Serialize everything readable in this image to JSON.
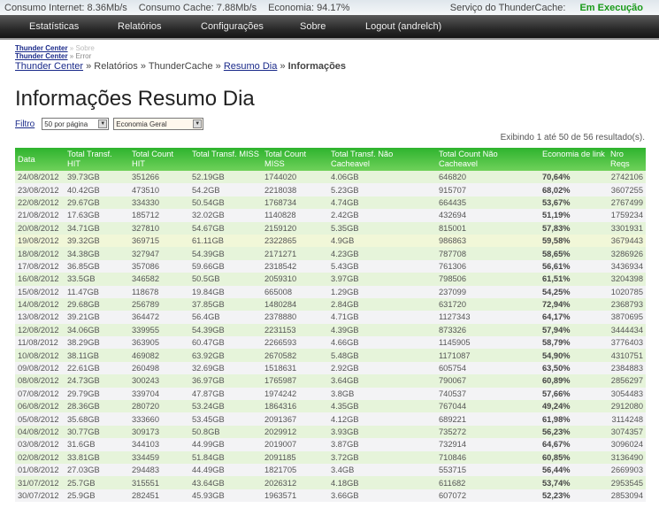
{
  "status": {
    "internet": "Consumo Internet: 8.36Mb/s",
    "cache": "Consumo Cache: 7.88Mb/s",
    "economia": "Economia: 94.17%",
    "service_label": "Serviço do ThunderCache:",
    "service_state": "Em Execução"
  },
  "nav": [
    "Estatísticas",
    "Relatórios",
    "Configurações",
    "Sobre",
    "Logout (andrelch)"
  ],
  "crumbs": {
    "small1_link": "Thunder Center",
    "small1_rest": "» Sobre",
    "small2_link": "Thunder Center",
    "small2_rest": "» Error",
    "main_link": "Thunder Center",
    "main_mid": "» Relatórios » ThunderCache »",
    "main_link2": "Resumo Dia",
    "main_sep": "»",
    "main_current": "Informações"
  },
  "title": "Informações Resumo Dia",
  "filter": {
    "label": "Filtro",
    "per_page": "50 por página",
    "mode": "Economia Geral"
  },
  "count": "Exibindo 1 até 50 de 56 resultado(s).",
  "headers": [
    "Data",
    "Total Transf. HIT",
    "Total Count HIT",
    "Total Transf. MISS",
    "Total Count MISS",
    "Total Transf. Não Cacheavel",
    "Total Count Não Cacheavel",
    "Economia de link",
    "Nro Reqs"
  ],
  "rows": [
    [
      "24/08/2012",
      "39.73GB",
      "351266",
      "52.19GB",
      "1744020",
      "4.06GB",
      "646820",
      "70,64%",
      "2742106"
    ],
    [
      "23/08/2012",
      "40.42GB",
      "473510",
      "54.2GB",
      "2218038",
      "5.23GB",
      "915707",
      "68,02%",
      "3607255"
    ],
    [
      "22/08/2012",
      "29.67GB",
      "334330",
      "50.54GB",
      "1768734",
      "4.74GB",
      "664435",
      "53,67%",
      "2767499"
    ],
    [
      "21/08/2012",
      "17.63GB",
      "185712",
      "32.02GB",
      "1140828",
      "2.42GB",
      "432694",
      "51,19%",
      "1759234"
    ],
    [
      "20/08/2012",
      "34.71GB",
      "327810",
      "54.67GB",
      "2159120",
      "5.35GB",
      "815001",
      "57,83%",
      "3301931"
    ],
    [
      "19/08/2012",
      "39.32GB",
      "369715",
      "61.11GB",
      "2322865",
      "4.9GB",
      "986863",
      "59,58%",
      "3679443"
    ],
    [
      "18/08/2012",
      "34.38GB",
      "327947",
      "54.39GB",
      "2171271",
      "4.23GB",
      "787708",
      "58,65%",
      "3286926"
    ],
    [
      "17/08/2012",
      "36.85GB",
      "357086",
      "59.66GB",
      "2318542",
      "5.43GB",
      "761306",
      "56,61%",
      "3436934"
    ],
    [
      "16/08/2012",
      "33.5GB",
      "346582",
      "50.5GB",
      "2059310",
      "3.97GB",
      "798506",
      "61,51%",
      "3204398"
    ],
    [
      "15/08/2012",
      "11.47GB",
      "118678",
      "19.84GB",
      "665008",
      "1.29GB",
      "237099",
      "54,25%",
      "1020785"
    ],
    [
      "14/08/2012",
      "29.68GB",
      "256789",
      "37.85GB",
      "1480284",
      "2.84GB",
      "631720",
      "72,94%",
      "2368793"
    ],
    [
      "13/08/2012",
      "39.21GB",
      "364472",
      "56.4GB",
      "2378880",
      "4.71GB",
      "1127343",
      "64,17%",
      "3870695"
    ],
    [
      "12/08/2012",
      "34.06GB",
      "339955",
      "54.39GB",
      "2231153",
      "4.39GB",
      "873326",
      "57,94%",
      "3444434"
    ],
    [
      "11/08/2012",
      "38.29GB",
      "363905",
      "60.47GB",
      "2266593",
      "4.66GB",
      "1145905",
      "58,79%",
      "3776403"
    ],
    [
      "10/08/2012",
      "38.11GB",
      "469082",
      "63.92GB",
      "2670582",
      "5.48GB",
      "1171087",
      "54,90%",
      "4310751"
    ],
    [
      "09/08/2012",
      "22.61GB",
      "260498",
      "32.69GB",
      "1518631",
      "2.92GB",
      "605754",
      "63,50%",
      "2384883"
    ],
    [
      "08/08/2012",
      "24.73GB",
      "300243",
      "36.97GB",
      "1765987",
      "3.64GB",
      "790067",
      "60,89%",
      "2856297"
    ],
    [
      "07/08/2012",
      "29.79GB",
      "339704",
      "47.87GB",
      "1974242",
      "3.8GB",
      "740537",
      "57,66%",
      "3054483"
    ],
    [
      "06/08/2012",
      "28.36GB",
      "280720",
      "53.24GB",
      "1864316",
      "4.35GB",
      "767044",
      "49,24%",
      "2912080"
    ],
    [
      "05/08/2012",
      "35.68GB",
      "333660",
      "53.45GB",
      "2091367",
      "4.12GB",
      "689221",
      "61,98%",
      "3114248"
    ],
    [
      "04/08/2012",
      "30.77GB",
      "309173",
      "50.8GB",
      "2029912",
      "3.93GB",
      "735272",
      "56,23%",
      "3074357"
    ],
    [
      "03/08/2012",
      "31.6GB",
      "344103",
      "44.99GB",
      "2019007",
      "3.87GB",
      "732914",
      "64,67%",
      "3096024"
    ],
    [
      "02/08/2012",
      "33.81GB",
      "334459",
      "51.84GB",
      "2091185",
      "3.72GB",
      "710846",
      "60,85%",
      "3136490"
    ],
    [
      "01/08/2012",
      "27.03GB",
      "294483",
      "44.49GB",
      "1821705",
      "3.4GB",
      "553715",
      "56,44%",
      "2669903"
    ],
    [
      "31/07/2012",
      "25.7GB",
      "315551",
      "43.64GB",
      "2026312",
      "4.18GB",
      "611682",
      "53,74%",
      "2953545"
    ],
    [
      "30/07/2012",
      "25.9GB",
      "282451",
      "45.93GB",
      "1963571",
      "3.66GB",
      "607072",
      "52,23%",
      "2853094"
    ]
  ]
}
